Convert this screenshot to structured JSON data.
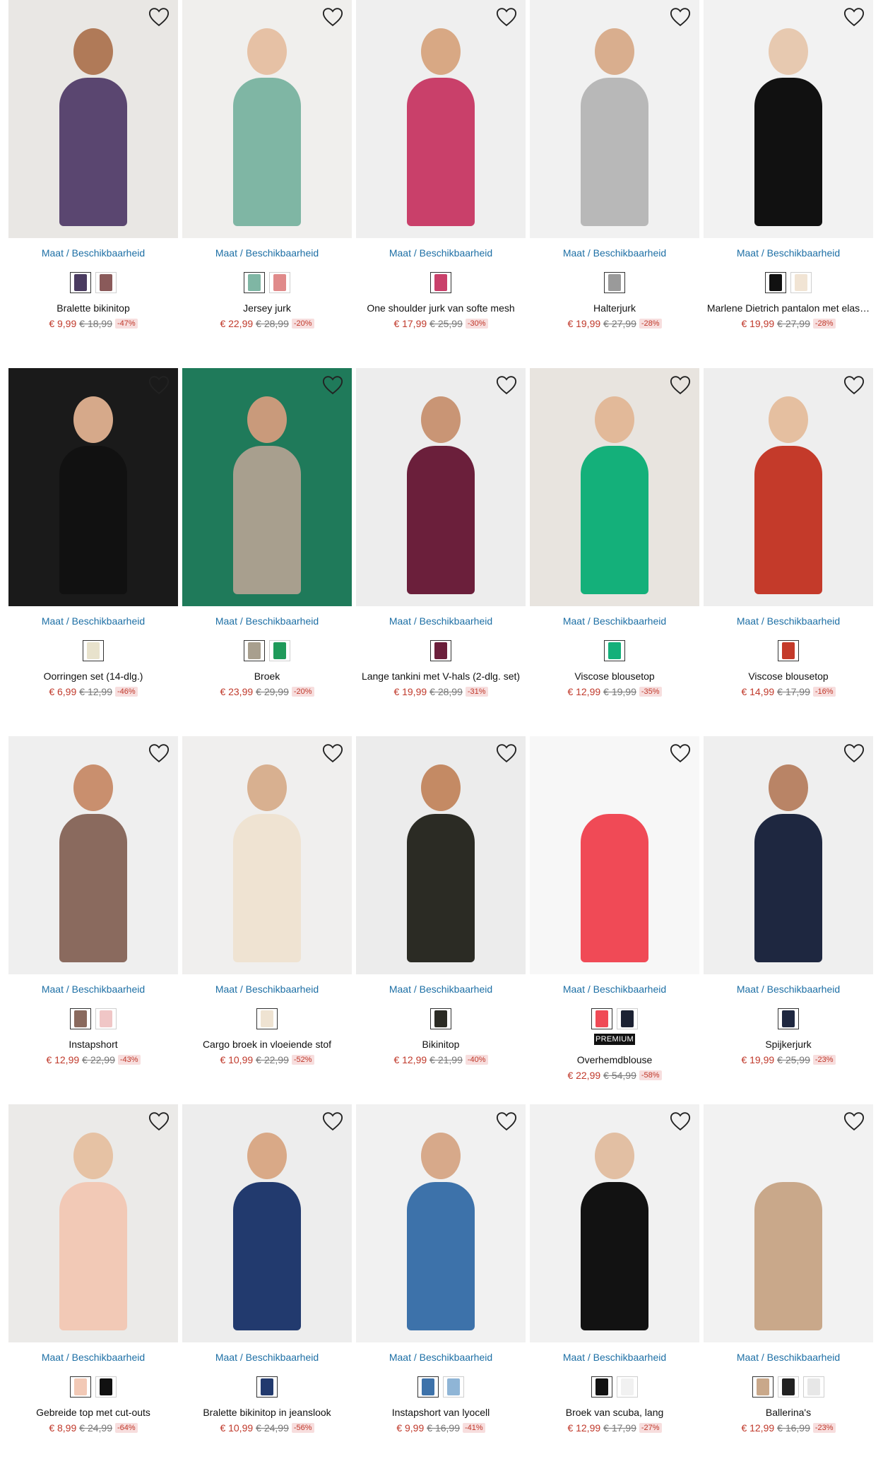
{
  "size_link_label": "Maat / Beschikbaarheid",
  "premium_label": "PREMIUM",
  "products": [
    {
      "name": "Bralette bikinitop",
      "price": "€ 9,99",
      "old_price": "€ 18,99",
      "discount": "-47%",
      "bg": "#e9e7e4",
      "body": "#5a4670",
      "skin": "#b07a58",
      "swatches": [
        "#4a3b60",
        "#8a5a5a"
      ],
      "premium": false
    },
    {
      "name": "Jersey jurk",
      "price": "€ 22,99",
      "old_price": "€ 28,99",
      "discount": "-20%",
      "bg": "#f0efed",
      "body": "#7fb6a4",
      "skin": "#e6c1a5",
      "swatches": [
        "#7fb6a4",
        "#e08a8a"
      ],
      "premium": false
    },
    {
      "name": "One shoulder jurk van softe mesh",
      "price": "€ 17,99",
      "old_price": "€ 25,99",
      "discount": "-30%",
      "bg": "#efefef",
      "body": "#c9406a",
      "skin": "#d8a884",
      "swatches": [
        "#c9406a"
      ],
      "premium": false
    },
    {
      "name": "Halterjurk",
      "price": "€ 19,99",
      "old_price": "€ 27,99",
      "discount": "-28%",
      "bg": "#f1f1f1",
      "body": "#b8b8b8",
      "skin": "#d9ae8e",
      "swatches": [
        "#9a9a9a"
      ],
      "premium": false
    },
    {
      "name": "Marlene Dietrich pantalon met elas…",
      "price": "€ 19,99",
      "old_price": "€ 27,99",
      "discount": "-28%",
      "bg": "#f2f2f2",
      "body": "#111111",
      "skin": "#e7c9b0",
      "swatches": [
        "#111111",
        "#f1e4d4"
      ],
      "premium": false
    },
    {
      "name": "Oorringen set (14-dlg.)",
      "price": "€ 6,99",
      "old_price": "€ 12,99",
      "discount": "-46%",
      "bg": "#1a1a1a",
      "body": "#111111",
      "skin": "#d6a98a",
      "swatches": [
        "#e8e2cc"
      ],
      "premium": false
    },
    {
      "name": "Broek",
      "price": "€ 23,99",
      "old_price": "€ 29,99",
      "discount": "-20%",
      "bg": "#1f7a5a",
      "body": "#a89f8e",
      "skin": "#c99a7b",
      "swatches": [
        "#a89f8e",
        "#1f9a5a"
      ],
      "premium": false
    },
    {
      "name": "Lange tankini met V-hals (2-dlg. set)",
      "price": "€ 19,99",
      "old_price": "€ 28,99",
      "discount": "-31%",
      "bg": "#ededed",
      "body": "#6b1f3b",
      "skin": "#c99575",
      "swatches": [
        "#6b1f3b"
      ],
      "premium": false
    },
    {
      "name": "Viscose blousetop",
      "price": "€ 12,99",
      "old_price": "€ 19,99",
      "discount": "-35%",
      "bg": "#e8e4df",
      "body": "#14b07a",
      "skin": "#e2b999",
      "swatches": [
        "#14b07a"
      ],
      "premium": false
    },
    {
      "name": "Viscose blousetop",
      "price": "€ 14,99",
      "old_price": "€ 17,99",
      "discount": "-16%",
      "bg": "#eeeeee",
      "body": "#c43a2a",
      "skin": "#e5bfa0",
      "swatches": [
        "#c43a2a"
      ],
      "premium": false
    },
    {
      "name": "Instapshort",
      "price": "€ 12,99",
      "old_price": "€ 22,99",
      "discount": "-43%",
      "bg": "#efefef",
      "body": "#8a6a5e",
      "skin": "#c98f6e",
      "swatches": [
        "#8a6a5e",
        "#f0c6c6"
      ],
      "premium": false
    },
    {
      "name": "Cargo broek in vloeiende stof",
      "price": "€ 10,99",
      "old_price": "€ 22,99",
      "discount": "-52%",
      "bg": "#f0efee",
      "body": "#efe3d2",
      "skin": "#d8b090",
      "swatches": [
        "#efe3d2"
      ],
      "premium": false
    },
    {
      "name": "Bikinitop",
      "price": "€ 12,99",
      "old_price": "€ 21,99",
      "discount": "-40%",
      "bg": "#ececec",
      "body": "#2b2b24",
      "skin": "#c48a64",
      "swatches": [
        "#2b2b24"
      ],
      "premium": false
    },
    {
      "name": "Overhemdblouse",
      "price": "€ 22,99",
      "old_price": "€ 54,99",
      "discount": "-58%",
      "bg": "#f7f7f7",
      "body": "#f04a56",
      "skin": "#f7f7f7",
      "swatches": [
        "#f04a56",
        "#1c2233"
      ],
      "premium": true
    },
    {
      "name": "Spijkerjurk",
      "price": "€ 19,99",
      "old_price": "€ 25,99",
      "discount": "-23%",
      "bg": "#efefef",
      "body": "#1e2740",
      "skin": "#b98466",
      "swatches": [
        "#1e2740"
      ],
      "premium": false
    },
    {
      "name": "Gebreide top met cut-outs",
      "price": "€ 8,99",
      "old_price": "€ 24,99",
      "discount": "-64%",
      "bg": "#ebeae8",
      "body": "#f2c9b6",
      "skin": "#e6c2a4",
      "swatches": [
        "#f2c9b6",
        "#111111"
      ],
      "premium": false
    },
    {
      "name": "Bralette bikinitop in jeanslook",
      "price": "€ 10,99",
      "old_price": "€ 24,99",
      "discount": "-56%",
      "bg": "#ededed",
      "body": "#223a6e",
      "skin": "#d9a987",
      "swatches": [
        "#223a6e"
      ],
      "premium": false
    },
    {
      "name": "Instapshort van lyocell",
      "price": "€ 9,99",
      "old_price": "€ 16,99",
      "discount": "-41%",
      "bg": "#f1f1f1",
      "body": "#3d72aa",
      "skin": "#d7a98a",
      "swatches": [
        "#3d72aa",
        "#8fb5d6"
      ],
      "premium": false
    },
    {
      "name": "Broek van scuba, lang",
      "price": "€ 12,99",
      "old_price": "€ 17,99",
      "discount": "-27%",
      "bg": "#f1f1f1",
      "body": "#121212",
      "skin": "#e2bfa3",
      "swatches": [
        "#121212",
        "#f1f1f1"
      ],
      "premium": false
    },
    {
      "name": "Ballerina's",
      "price": "€ 12,99",
      "old_price": "€ 16,99",
      "discount": "-23%",
      "bg": "#f2f2f2",
      "body": "#c9a88a",
      "skin": "#f2f2f2",
      "swatches": [
        "#c9a88a",
        "#222222",
        "#e7e7e7"
      ],
      "premium": false
    }
  ]
}
